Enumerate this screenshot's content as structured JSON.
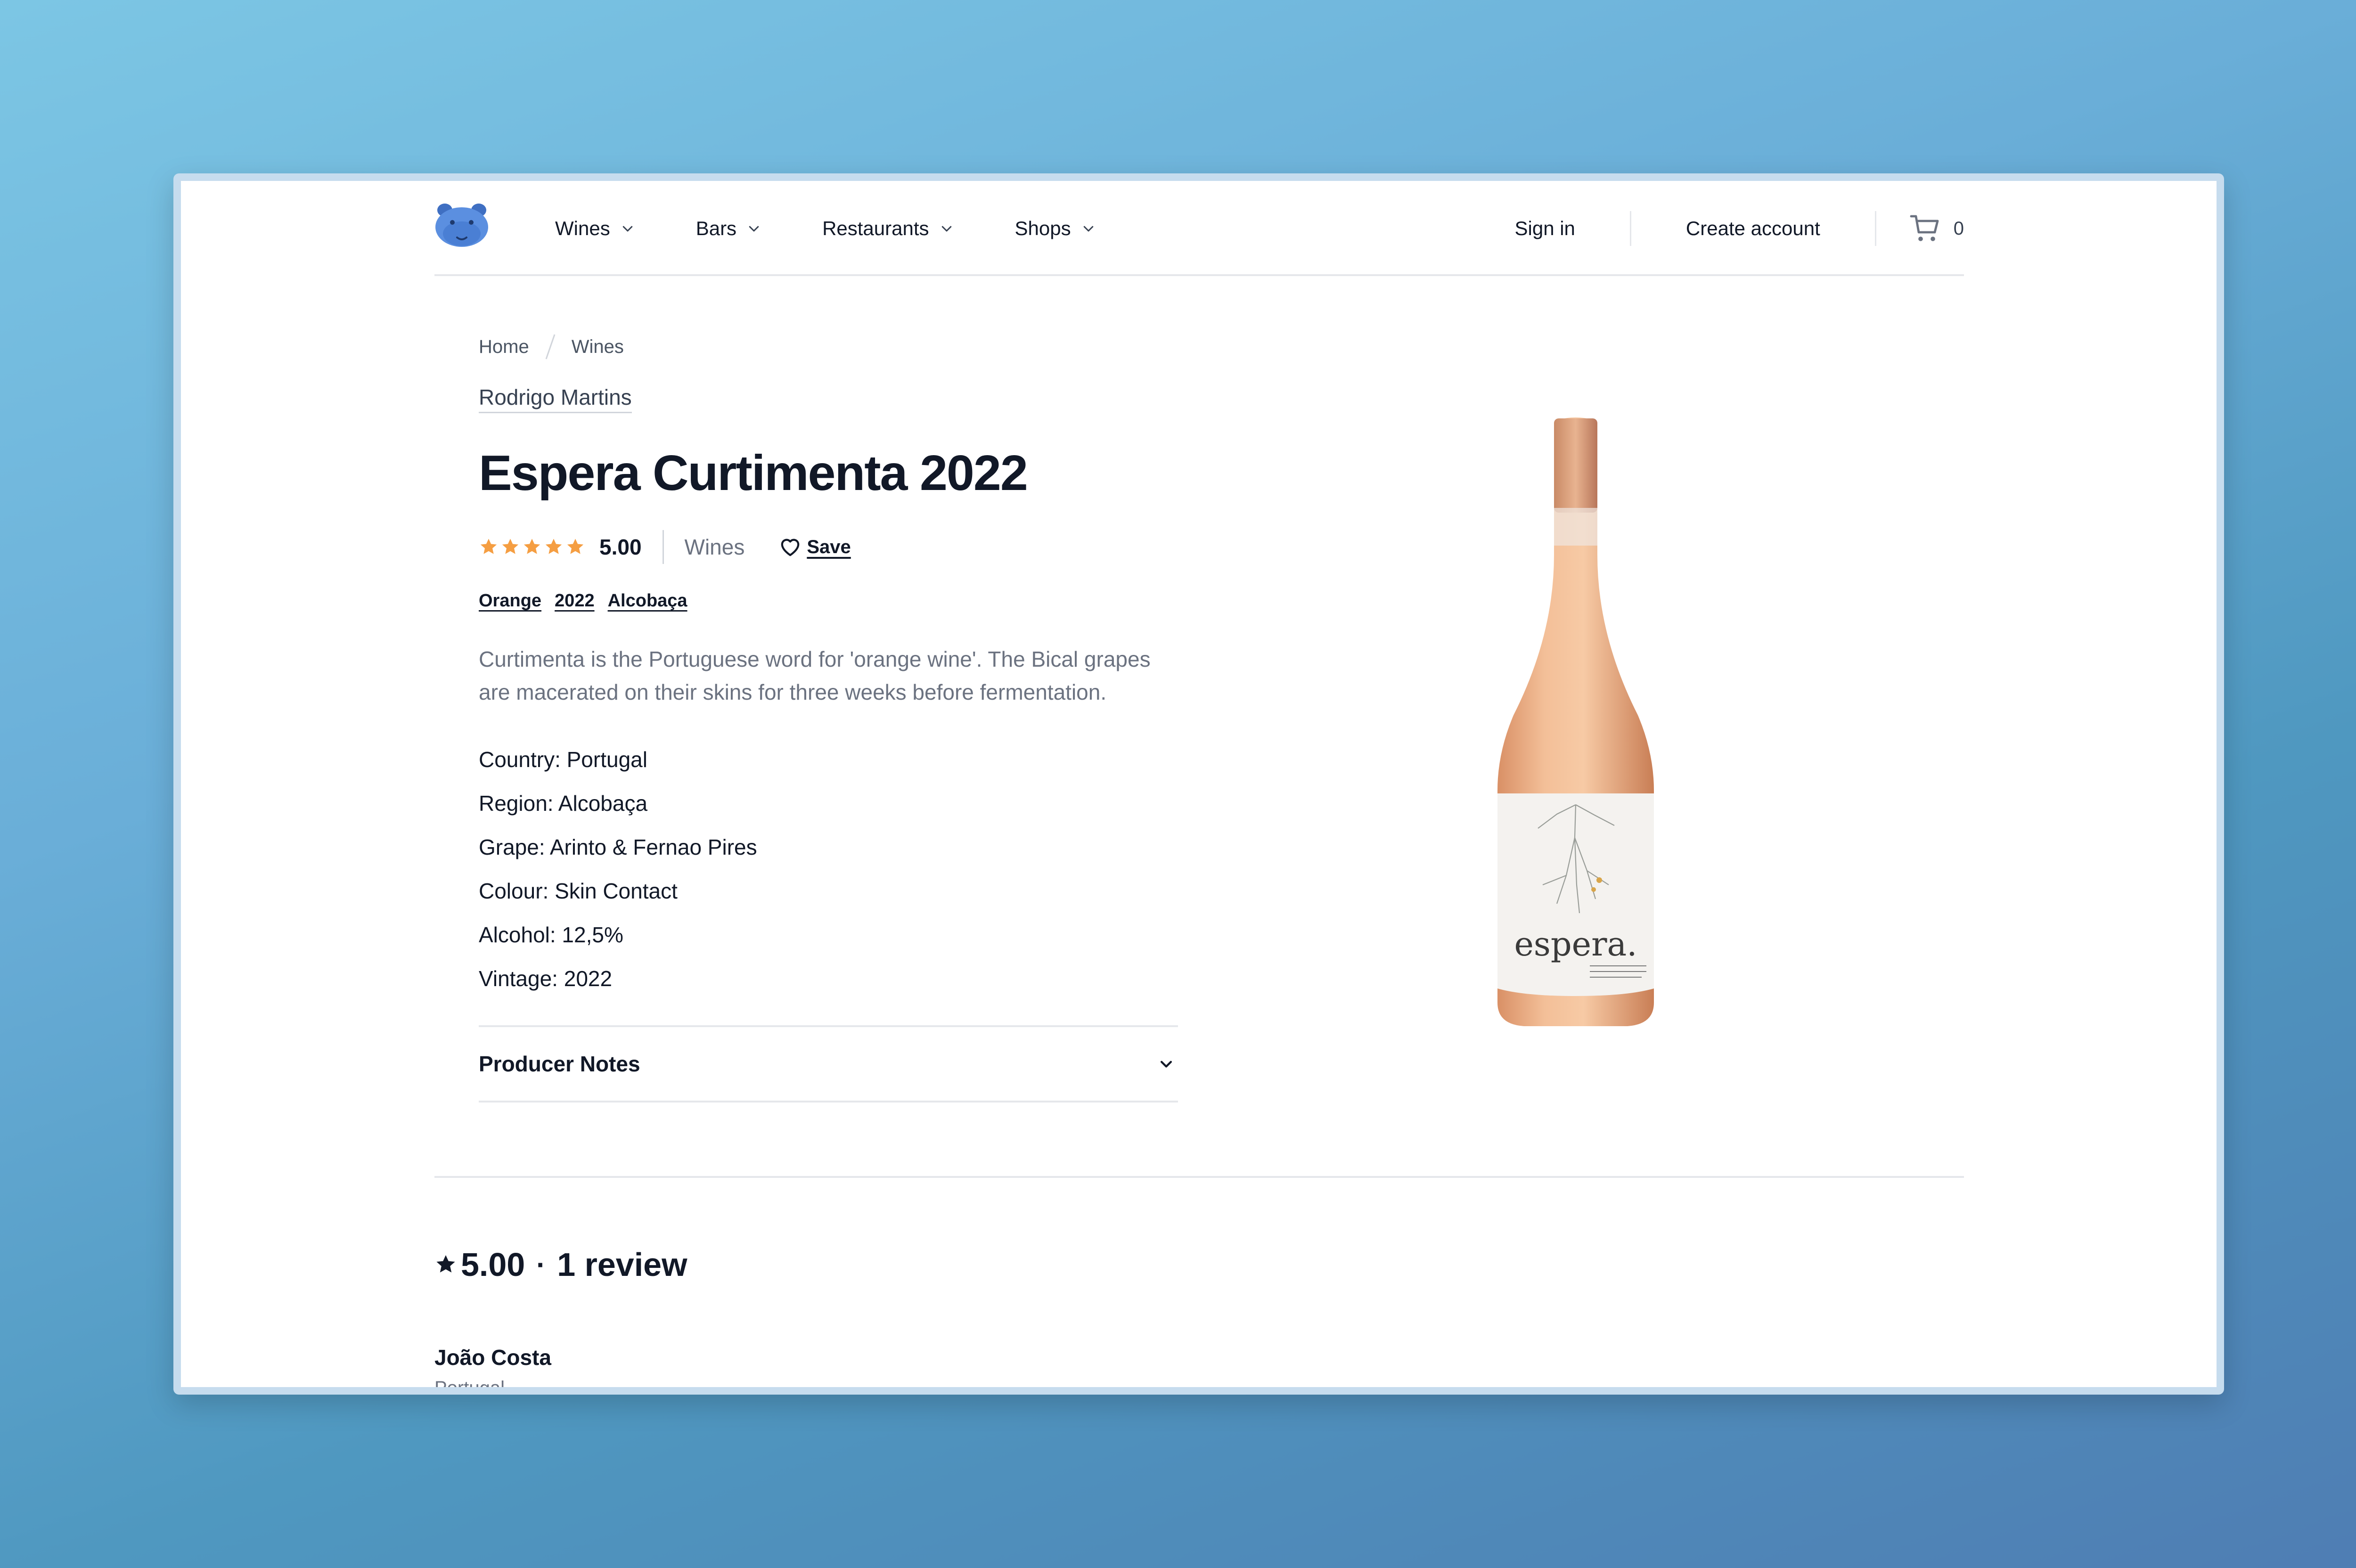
{
  "header": {
    "nav": [
      {
        "label": "Wines"
      },
      {
        "label": "Bars"
      },
      {
        "label": "Restaurants"
      },
      {
        "label": "Shops"
      }
    ],
    "sign_in": "Sign in",
    "create_account": "Create account",
    "cart_count": "0"
  },
  "breadcrumb": [
    "Home",
    "Wines"
  ],
  "product": {
    "producer": "Rodrigo Martins",
    "title": "Espera Curtimenta 2022",
    "rating": "5.00",
    "stars": 5,
    "category": "Wines",
    "save_label": "Save",
    "tags": [
      "Orange",
      "2022",
      "Alcobaça"
    ],
    "description": "Curtimenta is the Portuguese word for 'orange wine'. The Bical grapes are macerated on their skins for three weeks before fermentation.",
    "specs": [
      "Country: Portugal",
      "Region: Alcobaça",
      "Grape: Arinto & Fernao Pires",
      "Colour: Skin Contact",
      "Alcohol: 12,5%",
      "Vintage: 2022"
    ],
    "accordion_title": "Producer Notes",
    "bottle_label": "espera."
  },
  "reviews": {
    "rating": "5.00",
    "separator": "·",
    "count_label": "1 review",
    "items": [
      {
        "name": "João Costa",
        "country": "Portugal"
      }
    ]
  },
  "colors": {
    "star": "#f59e42",
    "text": "#111827",
    "muted": "#6b7280",
    "logo": "#4a7fd4"
  }
}
